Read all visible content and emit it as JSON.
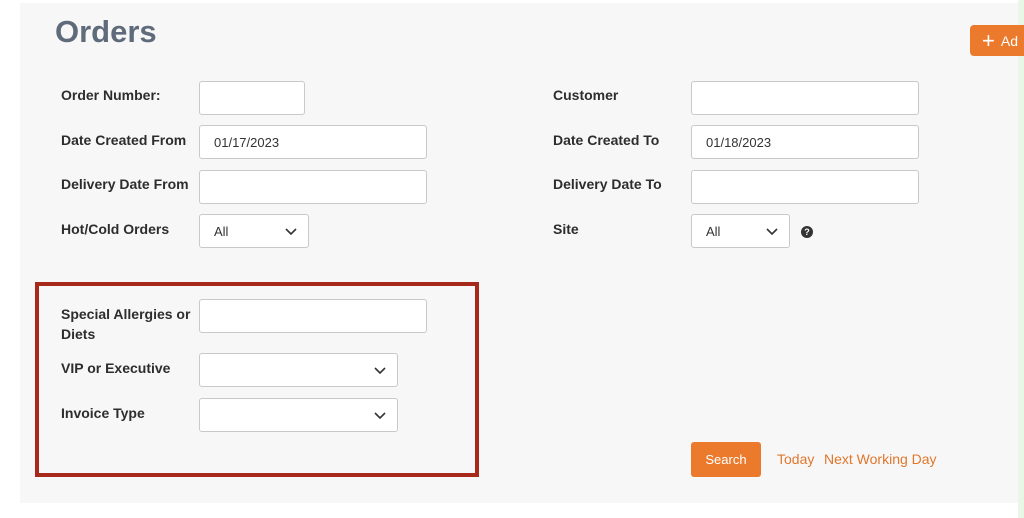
{
  "page": {
    "title": "Orders"
  },
  "add_button": {
    "label": "Ad"
  },
  "filters": {
    "order_number": {
      "label": "Order Number:",
      "value": ""
    },
    "customer": {
      "label": "Customer",
      "value": ""
    },
    "date_created_from": {
      "label": "Date Created From",
      "value": "01/17/2023"
    },
    "date_created_to": {
      "label": "Date Created To",
      "value": "01/18/2023"
    },
    "delivery_date_from": {
      "label": "Delivery Date From",
      "value": ""
    },
    "delivery_date_to": {
      "label": "Delivery Date To",
      "value": ""
    },
    "hot_cold_orders": {
      "label": "Hot/Cold Orders",
      "value": "All"
    },
    "site": {
      "label": "Site",
      "value": "All"
    },
    "special_allergies": {
      "label": "Special Allergies or Diets",
      "value": ""
    },
    "vip_executive": {
      "label": "VIP or Executive",
      "value": ""
    },
    "invoice_type": {
      "label": "Invoice Type",
      "value": ""
    }
  },
  "actions": {
    "search_label": "Search",
    "today_label": "Today",
    "next_working_day_label": "Next Working Day"
  },
  "colors": {
    "accent": "#ec7a2d",
    "highlight_border": "#a6291c",
    "title": "#5f6b7a"
  },
  "icons": {
    "add": "plus-icon",
    "dropdown": "chevron-down-icon",
    "help": "question-circle-icon"
  }
}
